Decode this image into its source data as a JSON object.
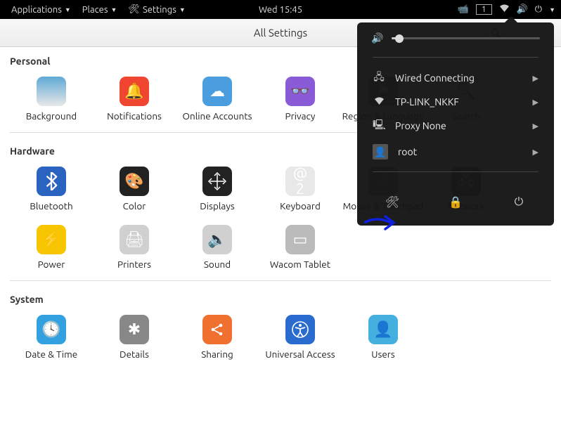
{
  "topbar": {
    "applications": "Applications",
    "places": "Places",
    "settings": "Settings",
    "clock": "Wed 15:45",
    "workspace": "1"
  },
  "header": {
    "title": "All Settings"
  },
  "sections": {
    "personal": {
      "title": "Personal",
      "items": [
        {
          "label": "Background"
        },
        {
          "label": "Notifications"
        },
        {
          "label": "Online Accounts"
        },
        {
          "label": "Privacy"
        },
        {
          "label": "Region & Language"
        },
        {
          "label": "Search"
        }
      ]
    },
    "hardware": {
      "title": "Hardware",
      "items": [
        {
          "label": "Bluetooth"
        },
        {
          "label": "Color"
        },
        {
          "label": "Displays"
        },
        {
          "label": "Keyboard",
          "keytop": "@",
          "keybot": "2"
        },
        {
          "label": "Mouse & Touchpad"
        },
        {
          "label": "Network"
        },
        {
          "label": "Power"
        },
        {
          "label": "Printers"
        },
        {
          "label": "Sound"
        },
        {
          "label": "Wacom Tablet"
        }
      ]
    },
    "system": {
      "title": "System",
      "items": [
        {
          "label": "Date & Time"
        },
        {
          "label": "Details"
        },
        {
          "label": "Sharing"
        },
        {
          "label": "Universal Access"
        },
        {
          "label": "Users"
        }
      ]
    }
  },
  "popup": {
    "wired": "Wired Connecting",
    "wifi": "TP-LINK_NKKF",
    "proxy": "Proxy None",
    "user": "root",
    "volume_percent": 5
  }
}
